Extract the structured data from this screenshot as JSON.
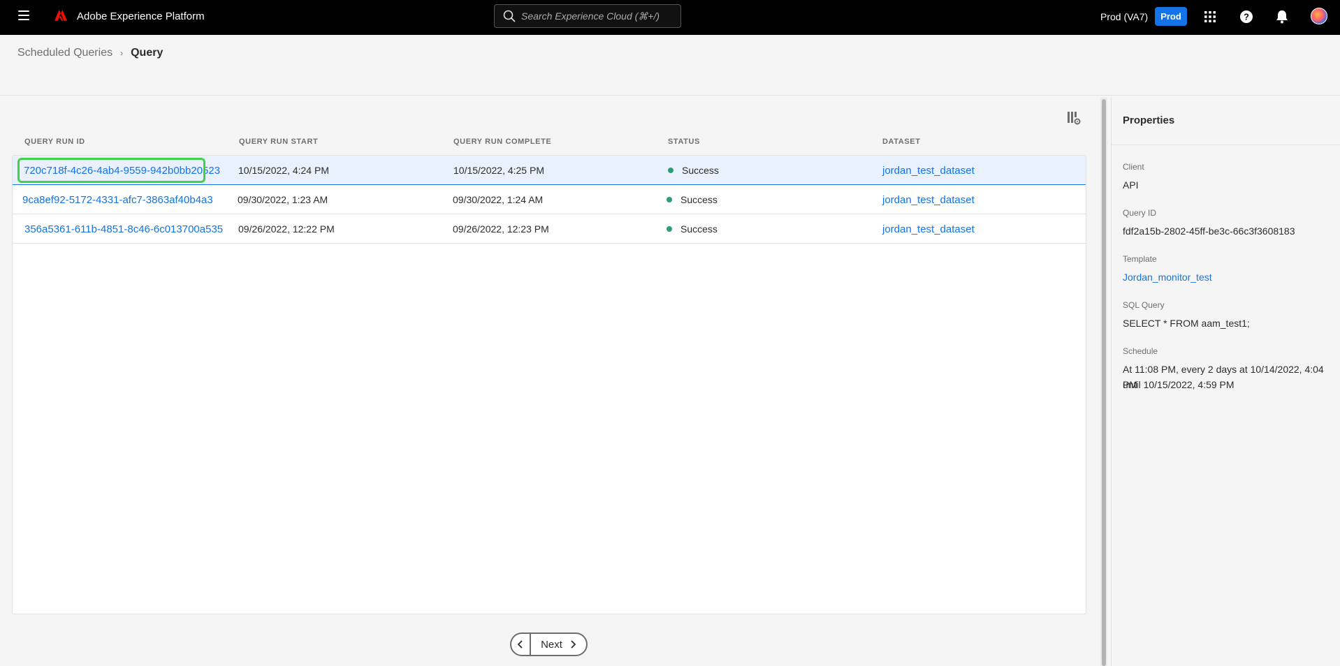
{
  "topbar": {
    "app_title": "Adobe Experience Platform",
    "search_placeholder": "Search Experience Cloud (⌘+/)",
    "org_name": "Prod (VA7)",
    "environment": "Prod",
    "icons": [
      "menu-icon",
      "adobe-logo",
      "search-icon",
      "apps-grid-icon",
      "help-icon",
      "bell-icon",
      "avatar"
    ]
  },
  "breadcrumb": {
    "parent": "Scheduled Queries",
    "current": "Query"
  },
  "table": {
    "columns": [
      "QUERY RUN ID",
      "QUERY RUN START",
      "QUERY RUN COMPLETE",
      "STATUS",
      "DATASET"
    ],
    "rows": [
      {
        "id": "720c718f-4c26-4ab4-9559-942b0bb20523",
        "start": "10/15/2022, 4:24 PM",
        "complete": "10/15/2022, 4:25 PM",
        "status": "Success",
        "dataset": "jordan_test_dataset"
      },
      {
        "id": "9ca8ef92-5172-4331-afc7-3863af40b4a3",
        "start": "09/30/2022, 1:23 AM",
        "complete": "09/30/2022, 1:24 AM",
        "status": "Success",
        "dataset": "jordan_test_dataset"
      },
      {
        "id": "356a5361-611b-4851-8c46-6c013700a535",
        "start": "09/26/2022, 12:22 PM",
        "complete": "09/26/2022, 12:23 PM",
        "status": "Success",
        "dataset": "jordan_test_dataset"
      }
    ],
    "status_color": "#2d9d78"
  },
  "pagination": {
    "next_label": "Next"
  },
  "properties": {
    "title": "Properties",
    "client_label": "Client",
    "client_value": "API",
    "query_id_label": "Query ID",
    "query_id_value": "fdf2a15b-2802-45ff-be3c-66c3f3608183",
    "template_label": "Template",
    "template_value": "Jordan_monitor_test",
    "sql_label": "SQL Query",
    "sql_value": "SELECT * FROM aam_test1;",
    "schedule_label": "Schedule",
    "schedule_line1": "At 11:08 PM, every 2 days at 10/14/2022, 4:04 PM",
    "schedule_line2": "until 10/15/2022, 4:59 PM"
  },
  "colors": {
    "accent": "#1473e6",
    "highlight": "#3fd14a",
    "adobe_red": "#eb1000"
  }
}
